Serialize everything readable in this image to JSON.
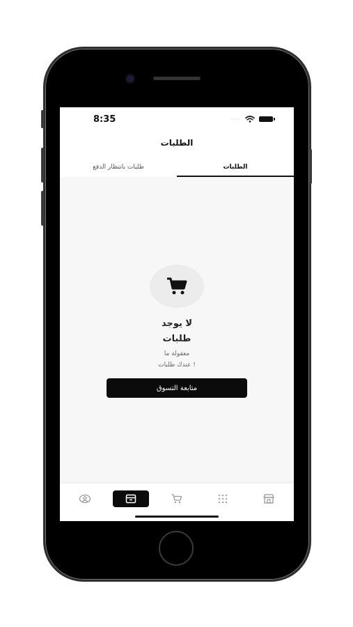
{
  "status_bar": {
    "time": "8:35",
    "signal_dots": "····",
    "wifi_icon": "wifi-icon",
    "battery_icon": "battery-icon"
  },
  "header": {
    "title": "الطلبات"
  },
  "tabs": [
    {
      "label": "الطلبات",
      "active": true
    },
    {
      "label": "طلبات بانتظار الدفع",
      "active": false
    }
  ],
  "empty_state": {
    "icon": "cart-icon",
    "title_line1": "لا يوجد",
    "title_line2": "طلبات",
    "subtitle_line1": "معقولة ما",
    "subtitle_line2": "عندك طلبات !",
    "button_label": "متابعة التسوق"
  },
  "bottom_nav": [
    {
      "icon": "store-icon",
      "active": false
    },
    {
      "icon": "grid-icon",
      "active": false
    },
    {
      "icon": "cart-icon",
      "active": false
    },
    {
      "icon": "orders-box-icon",
      "active": true
    },
    {
      "icon": "profile-icon",
      "active": false
    }
  ],
  "colors": {
    "primary": "#0b0b0b",
    "background": "#f7f7f7",
    "surface": "#ffffff",
    "muted": "#ececec"
  }
}
